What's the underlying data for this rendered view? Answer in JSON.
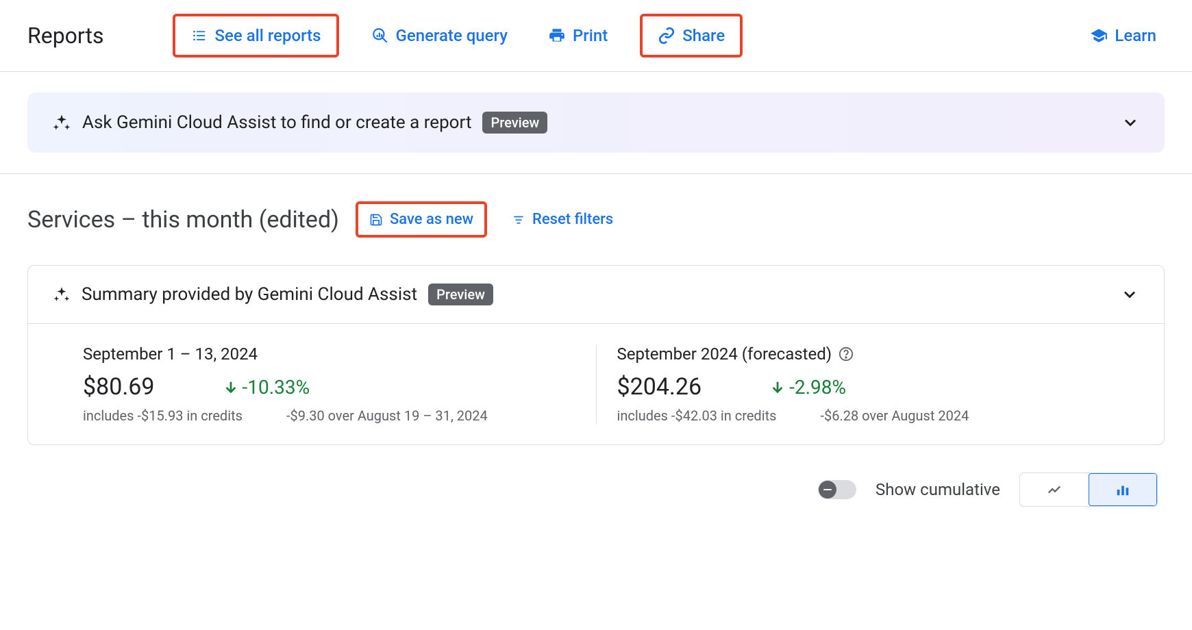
{
  "topbar": {
    "title": "Reports",
    "see_all": "See all reports",
    "generate": "Generate query",
    "print": "Print",
    "share": "Share",
    "learn": "Learn"
  },
  "gemini": {
    "prompt": "Ask Gemini Cloud Assist to find or create a report",
    "badge": "Preview"
  },
  "report": {
    "title": "Services – this month (edited)",
    "save_as_new": "Save as new",
    "reset_filters": "Reset filters"
  },
  "summary": {
    "heading": "Summary provided by Gemini Cloud Assist",
    "badge": "Preview",
    "left": {
      "period": "September 1 – 13, 2024",
      "amount": "$80.69",
      "delta": "-10.33%",
      "credits": "includes -$15.93 in credits",
      "compare": "-$9.30 over August 19 – 31, 2024"
    },
    "right": {
      "period": "September 2024 (forecasted)",
      "amount": "$204.26",
      "delta": "-2.98%",
      "credits": "includes -$42.03 in credits",
      "compare": "-$6.28 over August 2024"
    }
  },
  "footer": {
    "cumulative": "Show cumulative"
  },
  "colors": {
    "link": "#1a73e8",
    "highlight": "#e8442a",
    "positive": "#188038"
  }
}
